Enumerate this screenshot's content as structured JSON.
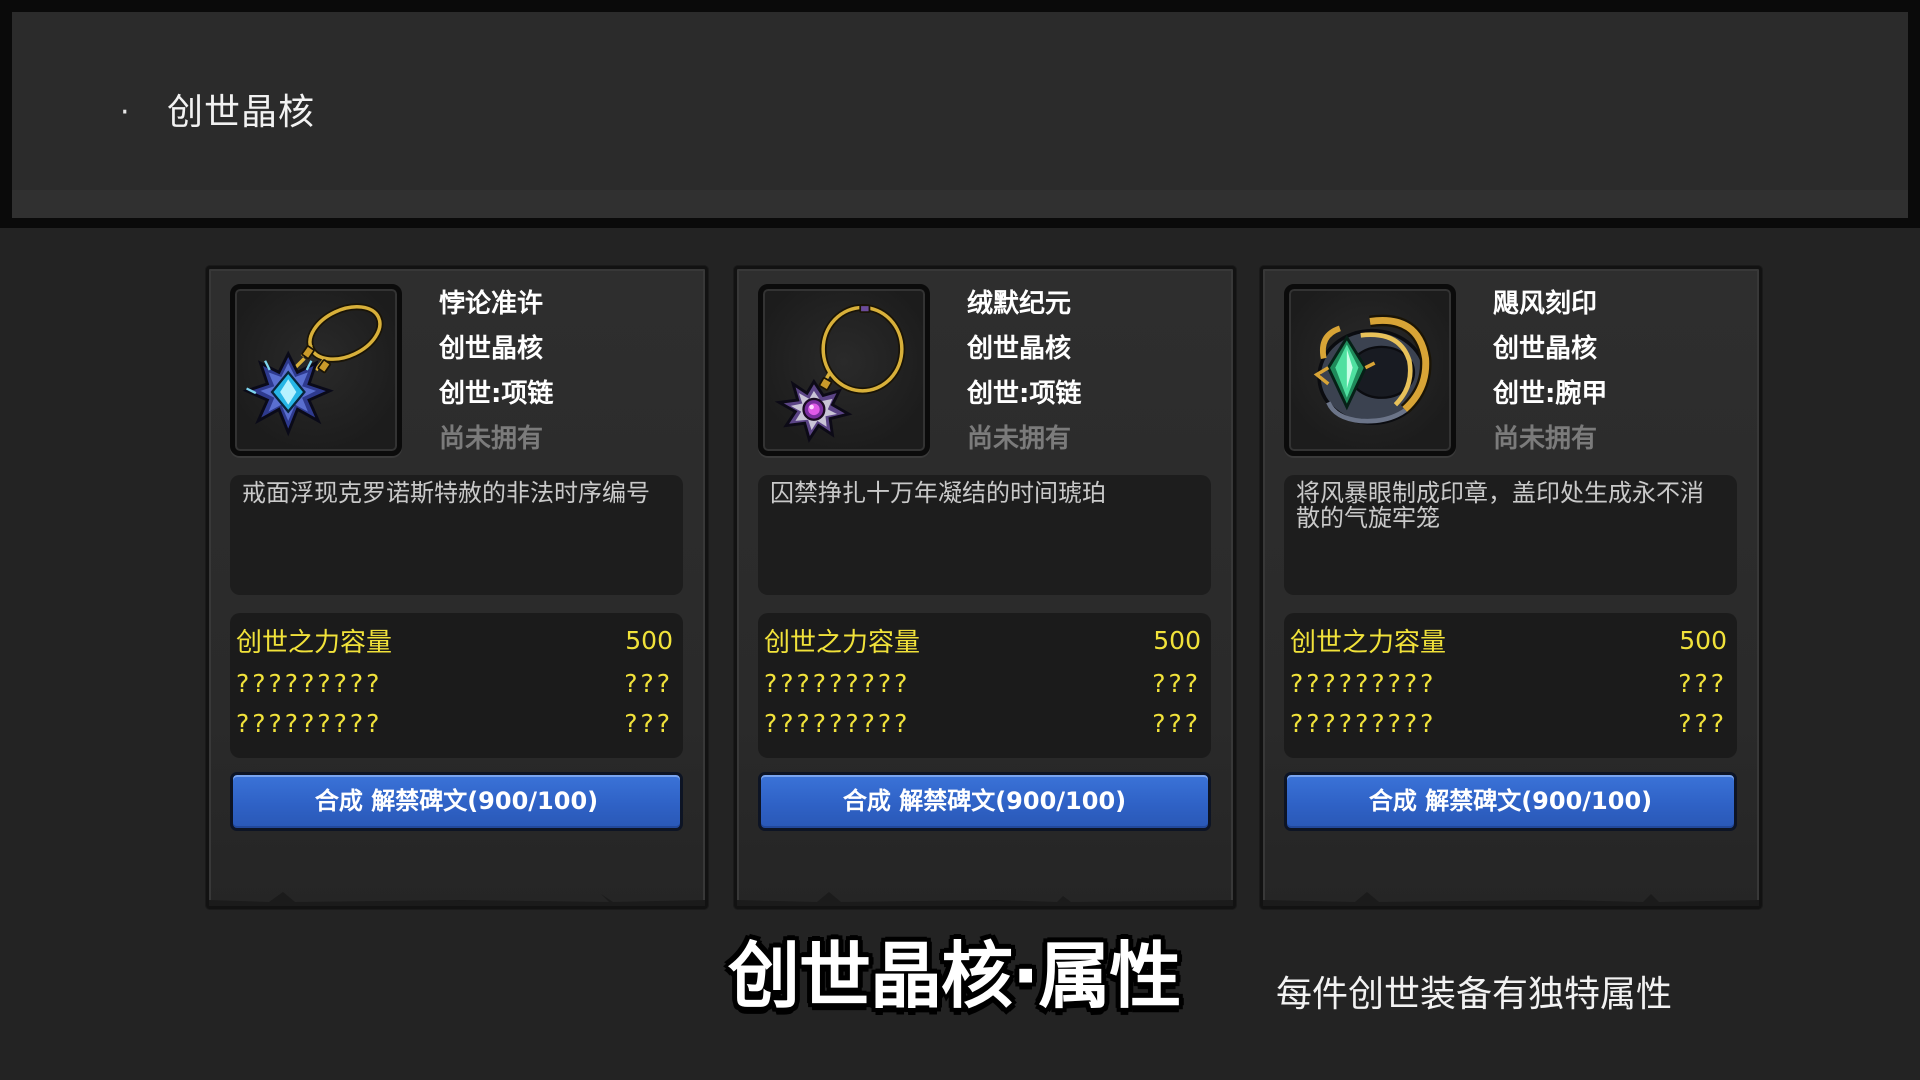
{
  "header": {
    "bullet": "·",
    "title": "创世晶核"
  },
  "cards": [
    {
      "icon": "blue-crystal-necklace-icon",
      "name": "悖论准许",
      "category": "创世晶核",
      "slot": "创世:项链",
      "status": "尚未拥有",
      "description": "戒面浮现克罗诺斯特赦的非法时序编号",
      "stats": [
        {
          "label": "创世之力容量",
          "value": "500"
        },
        {
          "label": "?????????",
          "value": "???"
        },
        {
          "label": "?????????",
          "value": "???"
        }
      ],
      "button_label": "合成 解禁碑文(900/100)"
    },
    {
      "icon": "purple-gem-necklace-icon",
      "name": "绒默纪元",
      "category": "创世晶核",
      "slot": "创世:项链",
      "status": "尚未拥有",
      "description": "囚禁挣扎十万年凝结的时间琥珀",
      "stats": [
        {
          "label": "创世之力容量",
          "value": "500"
        },
        {
          "label": "?????????",
          "value": "???"
        },
        {
          "label": "?????????",
          "value": "???"
        }
      ],
      "button_label": "合成 解禁碑文(900/100)"
    },
    {
      "icon": "green-crystal-bracer-icon",
      "name": "飓风刻印",
      "category": "创世晶核",
      "slot": "创世:腕甲",
      "status": "尚未拥有",
      "description": "将风暴眼制成印章，盖印处生成永不消散的气旋牢笼",
      "stats": [
        {
          "label": "创世之力容量",
          "value": "500"
        },
        {
          "label": "?????????",
          "value": "???"
        },
        {
          "label": "?????????",
          "value": "???"
        }
      ],
      "button_label": "合成 解禁碑文(900/100)"
    }
  ],
  "footer": {
    "title": "创世晶核·属性",
    "subtitle": "每件创世装备有独特属性"
  },
  "colors": {
    "page_background": "#232323",
    "header_panel": "#2b2b2b",
    "card_background": "#2c2c2c",
    "inner_box": "#1c1c1c",
    "stat_text": "#f1e23a",
    "status_text": "#7b7b7b",
    "button_blue": "#2f62c6"
  }
}
